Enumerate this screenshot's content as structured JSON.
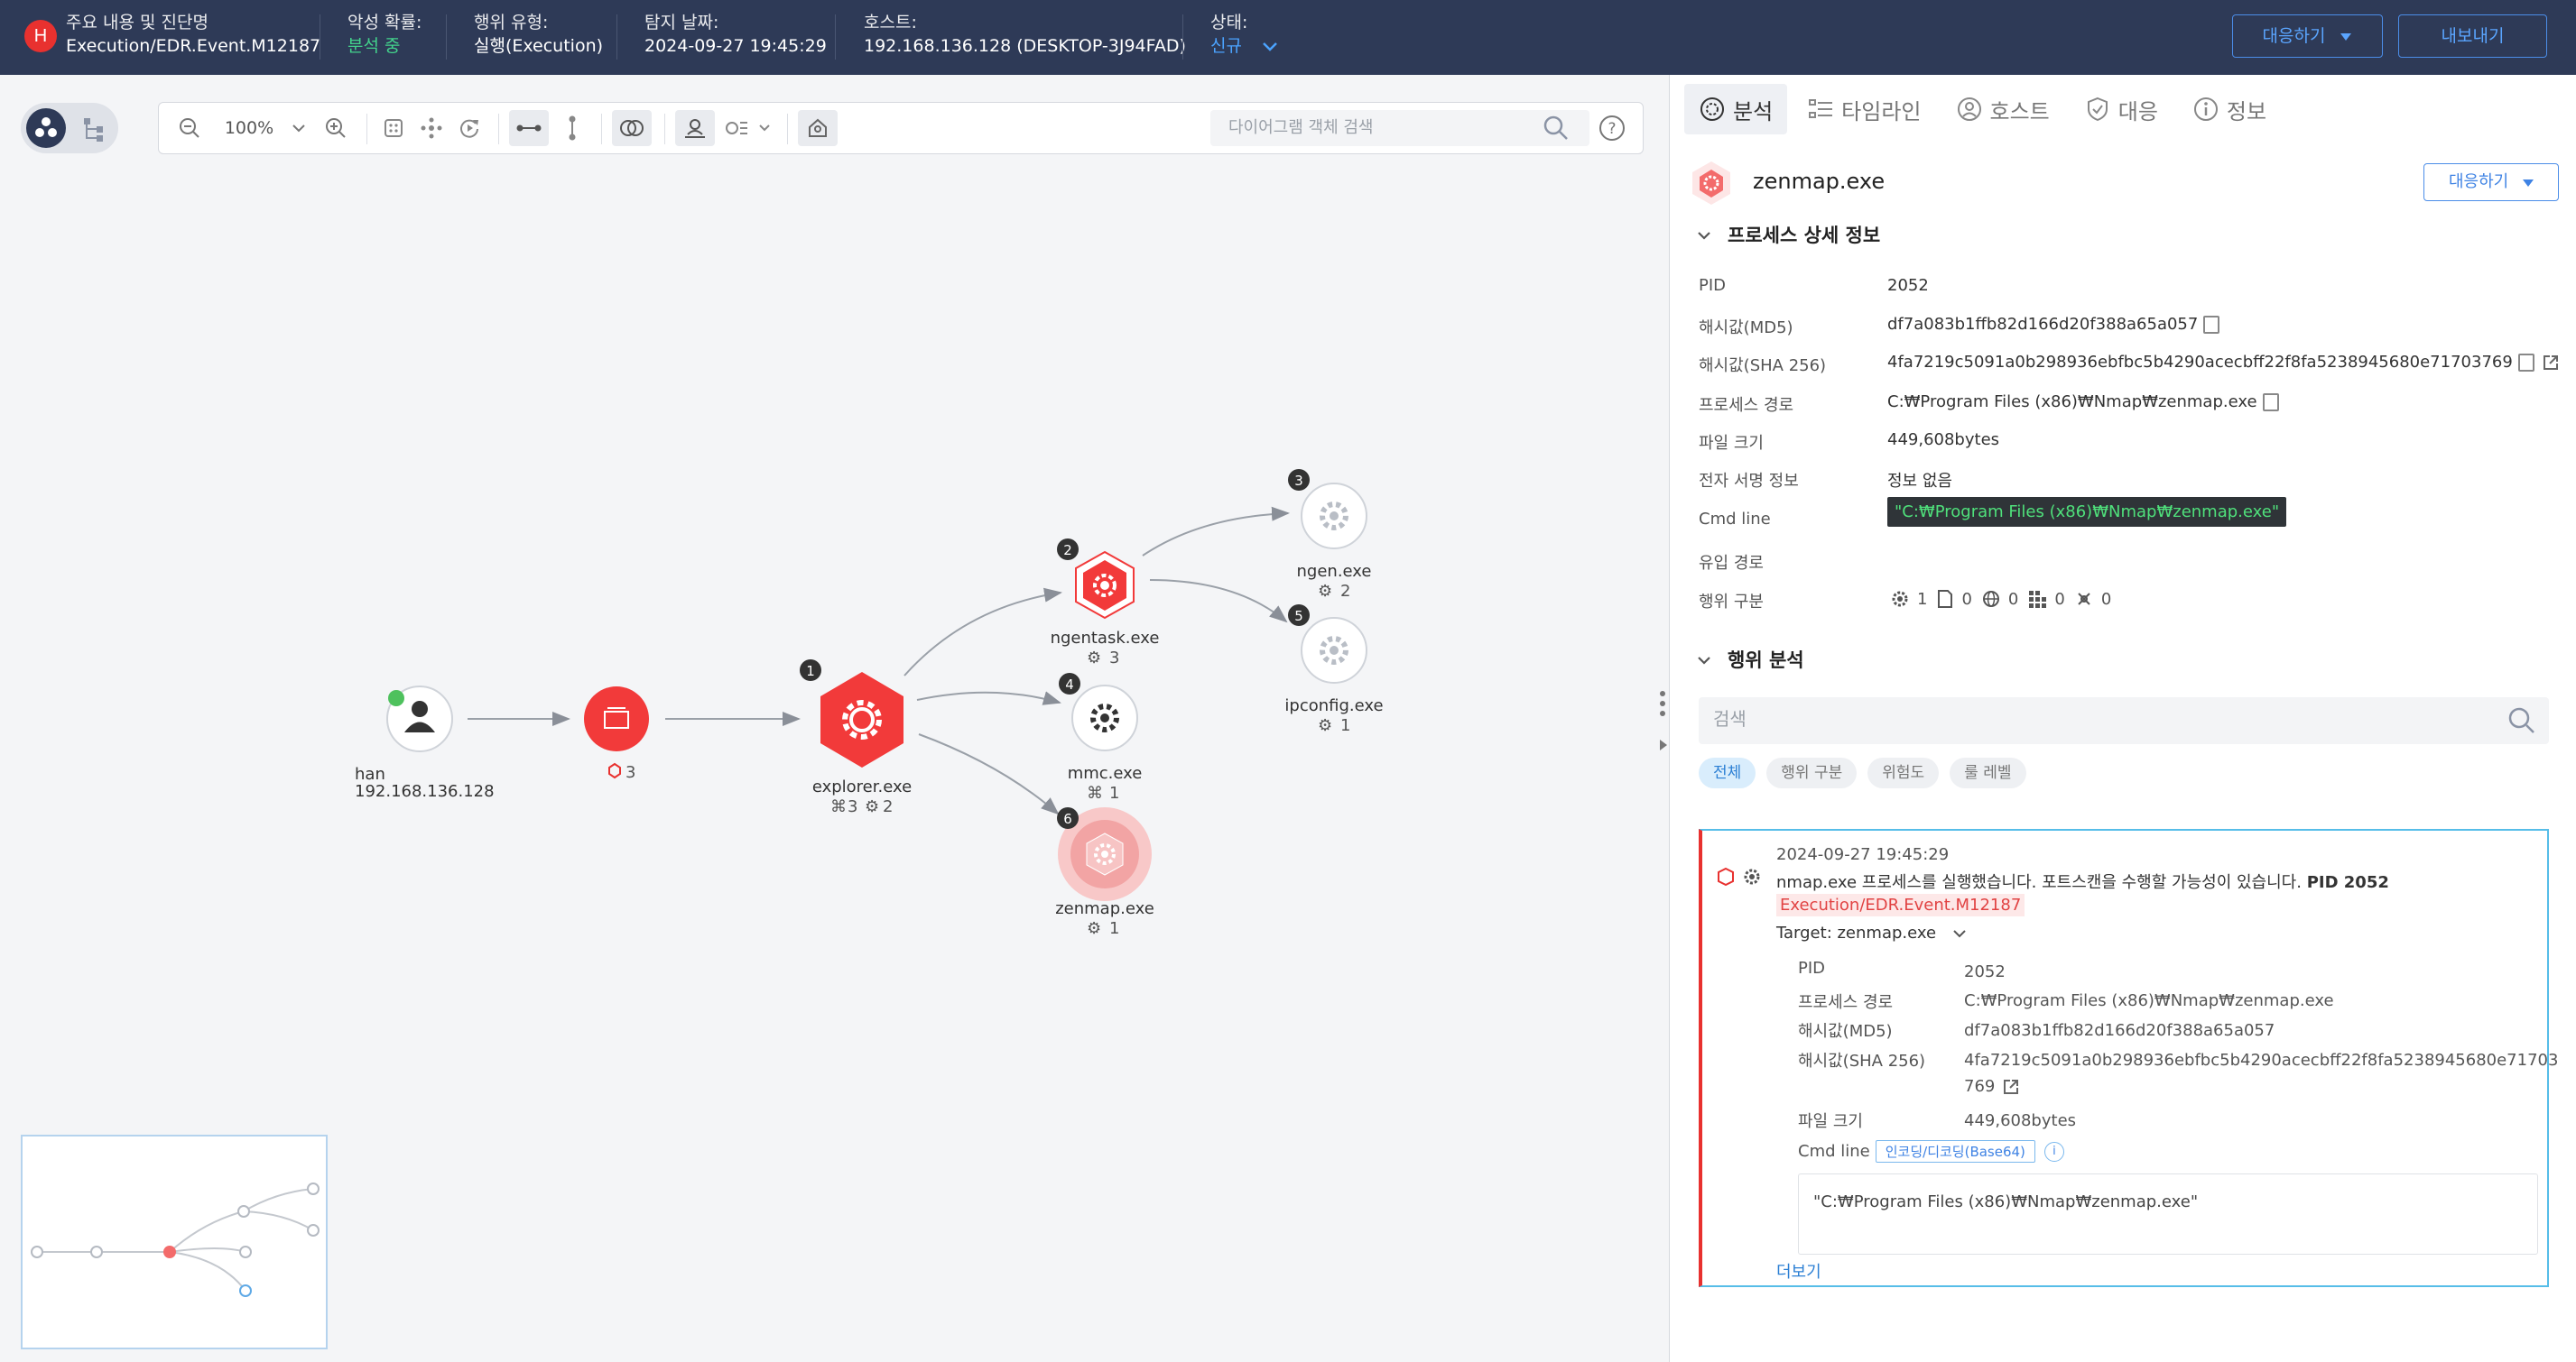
{
  "header": {
    "badge": "H",
    "summary_label": "주요 내용 및 진단명",
    "summary_value": "Execution/EDR.Event.M12187",
    "malicious_label": "악성 확률:",
    "malicious_value": "분석 중",
    "behavior_label": "행위 유형:",
    "behavior_value": "실행(Execution)",
    "detect_label": "탐지 날짜:",
    "detect_value": "2024-09-27 19:45:29",
    "host_label": "호스트:",
    "host_value": "192.168.136.128 (DESKTOP-3J94FAD)",
    "status_label": "상태:",
    "status_value": "신규",
    "respond_button": "대응하기",
    "export_button": "내보내기"
  },
  "toolbar": {
    "zoom": "100%",
    "search_placeholder": "다이어그램 객체 검색"
  },
  "graph": {
    "user_node": {
      "name": "han",
      "ip": "192.168.136.128"
    },
    "group_node": {
      "count": "3"
    },
    "nodes": [
      {
        "id": "explorer",
        "badge": "1",
        "name": "explorer.exe",
        "stat_a": "3",
        "stat_b": "2"
      },
      {
        "id": "ngentask",
        "badge": "2",
        "name": "ngentask.exe",
        "stat_a": "3"
      },
      {
        "id": "ngen",
        "badge": "3",
        "name": "ngen.exe",
        "stat_a": "2"
      },
      {
        "id": "mmc",
        "badge": "4",
        "name": "mmc.exe",
        "stat_a": "1"
      },
      {
        "id": "ipconfig",
        "badge": "5",
        "name": "ipconfig.exe",
        "stat_a": "1"
      },
      {
        "id": "zenmap",
        "badge": "6",
        "name": "zenmap.exe",
        "stat_a": "1"
      }
    ]
  },
  "panel": {
    "tabs": [
      "분석",
      "타임라인",
      "호스트",
      "대응",
      "정보"
    ],
    "process_name": "zenmap.exe",
    "respond_button": "대응하기",
    "details_title": "프로세스 상세 정보",
    "details": {
      "pid_label": "PID",
      "pid": "2052",
      "md5_label": "해시값(MD5)",
      "md5": "df7a083b1ffb82d166d20f388a65a057",
      "sha_label": "해시값(SHA 256)",
      "sha": "4fa7219c5091a0b298936ebfbc5b4290acecbff22f8fa5238945680e71703769",
      "path_label": "프로세스 경로",
      "path": "C:₩Program Files (x86)₩Nmap₩zenmap.exe",
      "size_label": "파일 크기",
      "size": "449,608bytes",
      "sign_label": "전자 서명 정보",
      "sign": "정보 없음",
      "cmd_label": "Cmd line",
      "cmd": "\"C:₩Program Files (x86)₩Nmap₩zenmap.exe\"",
      "inflow_label": "유입 경로",
      "behavior_label": "행위 구분",
      "behavior_counts": [
        "1",
        "0",
        "0",
        "0",
        "0"
      ]
    },
    "behavior_title": "행위 분석",
    "search_placeholder": "검색",
    "filters": [
      "전체",
      "행위 구분",
      "위험도",
      "룰 레벨"
    ],
    "event": {
      "time": "2024-09-27 19:45:29",
      "message": "nmap.exe 프로세스를 실행했습니다. 포트스캔을 수행할 가능성이 있습니다.",
      "pid_tag": "PID 2052",
      "rule": "Execution/EDR.Event.M12187",
      "target": "Target: zenmap.exe",
      "pid_label": "PID",
      "pid": "2052",
      "path_label": "프로세스 경로",
      "path": "C:₩Program Files (x86)₩Nmap₩zenmap.exe",
      "md5_label": "해시값(MD5)",
      "md5": "df7a083b1ffb82d166d20f388a65a057",
      "sha_label": "해시값(SHA 256)",
      "sha_1": "4fa7219c5091a0b298936ebfbc5b4290acecbff22f8fa5238945680e71703",
      "sha_2": "769",
      "size_label": "파일 크기",
      "size": "449,608bytes",
      "cmd_label": "Cmd line",
      "encode_btn": "인코딩/디코딩(Base64)",
      "info": "i",
      "cmd": "\"C:₩Program Files (x86)₩Nmap₩zenmap.exe\"",
      "more": "더보기"
    }
  },
  "colors": {
    "header_bg": "#2e3a57",
    "accent_red": "#e8312f",
    "accent_blue": "#4b8de8",
    "status_green": "#43d38c"
  }
}
